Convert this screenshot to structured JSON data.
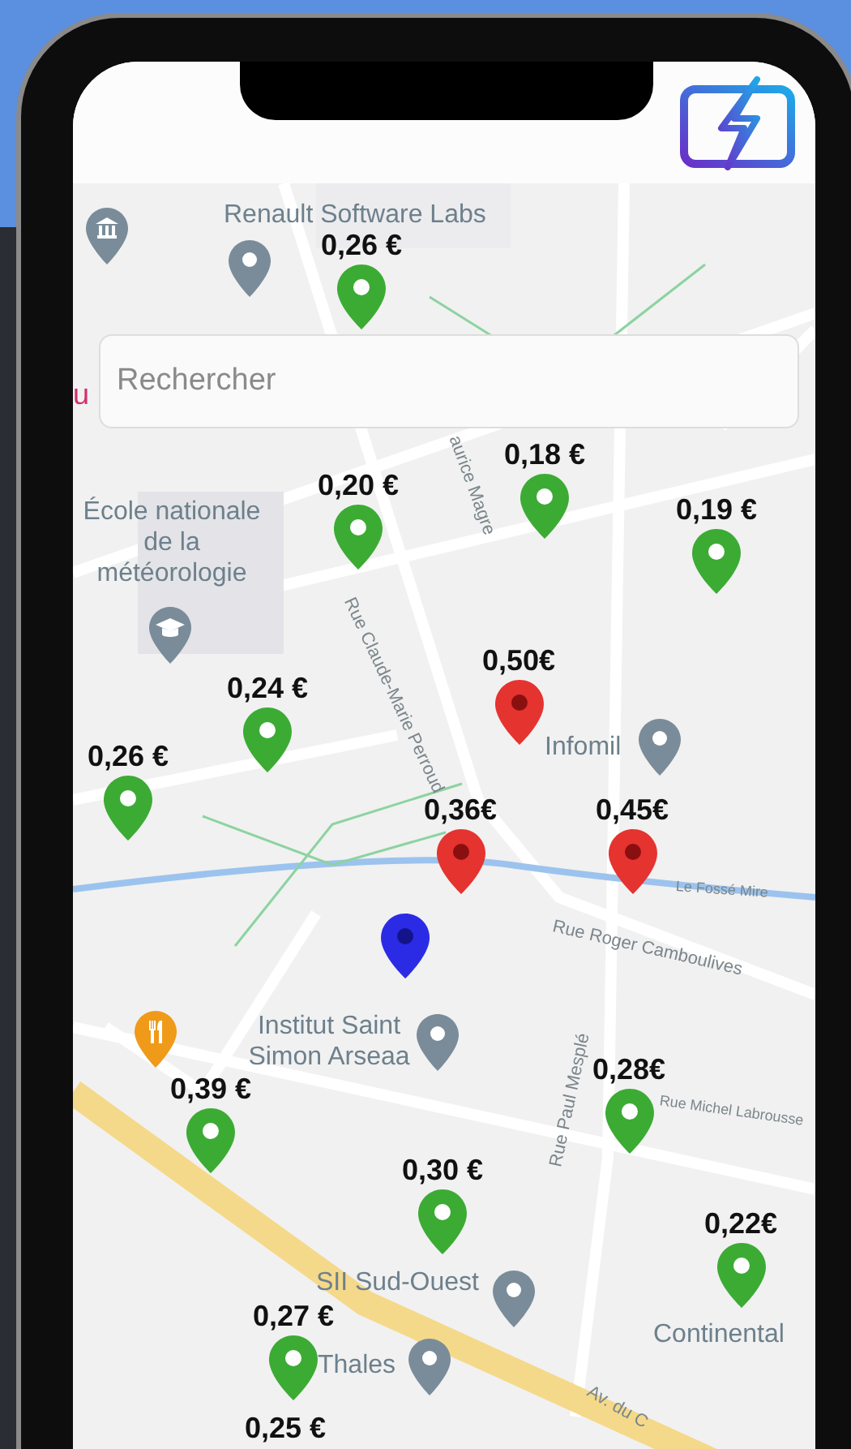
{
  "header": {
    "logo": {
      "kind": "bolt"
    }
  },
  "search": {
    "placeholder": "Rechercher"
  },
  "map": {
    "places": [
      {
        "name": "Renault Software Labs"
      },
      {
        "name": "École nationale de la météorologie"
      },
      {
        "name": "Infomil"
      },
      {
        "name": "Institut Saint Simon Arseaa"
      },
      {
        "name": "SII Sud-Ouest"
      },
      {
        "name": "Thales"
      },
      {
        "name": "Continental"
      }
    ],
    "streets": [
      {
        "name": "Rue Claude-Marie Perroud"
      },
      {
        "name": "aurice Magre"
      },
      {
        "name": "Rue Roger Camboulives"
      },
      {
        "name": "Le Fossé Mire"
      },
      {
        "name": "Rue Paul Mesplé"
      },
      {
        "name": "Rue Michel Labrousse"
      },
      {
        "name": "Av. du C"
      },
      {
        "name": "u"
      }
    ],
    "stations": [
      {
        "kind": "cheap",
        "price": "0,26 €",
        "color": "#3cab34"
      },
      {
        "kind": "cheap",
        "price": "0,18 €",
        "color": "#3cab34"
      },
      {
        "kind": "cheap",
        "price": "0,20 €",
        "color": "#3cab34"
      },
      {
        "kind": "cheap",
        "price": "0,19 €",
        "color": "#3cab34"
      },
      {
        "kind": "expensive",
        "price": "0,50€",
        "color": "#e53330"
      },
      {
        "kind": "cheap",
        "price": "0,24 €",
        "color": "#3cab34"
      },
      {
        "kind": "cheap",
        "price": "0,26 €",
        "color": "#3cab34"
      },
      {
        "kind": "expensive",
        "price": "0,36€",
        "color": "#e53330"
      },
      {
        "kind": "expensive",
        "price": "0,45€",
        "color": "#e53330"
      },
      {
        "kind": "user",
        "color": "#2b2be6"
      },
      {
        "kind": "cheap",
        "price": "0,28€",
        "color": "#3cab34"
      },
      {
        "kind": "cheap",
        "price": "0,39 €",
        "color": "#3cab34"
      },
      {
        "kind": "cheap",
        "price": "0,30 €",
        "color": "#3cab34"
      },
      {
        "kind": "cheap",
        "price": "0,22€",
        "color": "#3cab34"
      },
      {
        "kind": "cheap",
        "price": "0,27 €",
        "color": "#3cab34"
      },
      {
        "kind": "price-only",
        "price": "0,25 €"
      }
    ]
  }
}
